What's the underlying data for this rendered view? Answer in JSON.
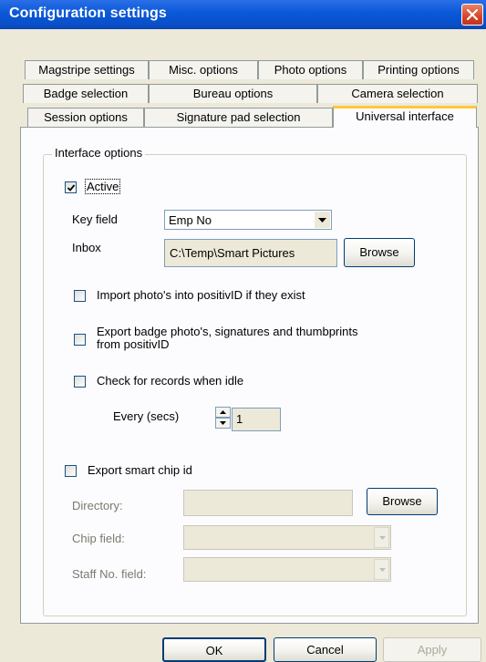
{
  "window": {
    "title": "Configuration settings",
    "close_icon": "close-icon"
  },
  "tabs": {
    "row1": [
      "Magstripe settings",
      "Misc. options",
      "Photo options",
      "Printing options"
    ],
    "row2": [
      "Badge selection",
      "Bureau options",
      "Camera selection"
    ],
    "row3": [
      "Session options",
      "Signature pad selection",
      "Universal interface"
    ],
    "active": "Universal interface"
  },
  "interface": {
    "group_label": "Interface options",
    "active": {
      "label": "Active",
      "checked": true
    },
    "key_field": {
      "label": "Key field",
      "value": "Emp No"
    },
    "inbox": {
      "label": "Inbox",
      "value": "C:\\Temp\\Smart Pictures",
      "browse": "Browse"
    },
    "import_photos": {
      "label": "Import photo's into positivID if they exist",
      "checked": false
    },
    "export_badge": {
      "label_line1": "Export badge photo's, signatures and thumbprints",
      "label_line2": "from positivID",
      "checked": false
    },
    "check_idle": {
      "label": "Check for records when idle",
      "checked": false
    },
    "every": {
      "label": "Every (secs)",
      "value": "1"
    },
    "export_chip": {
      "label": "Export smart chip id",
      "checked": false
    },
    "directory": {
      "label": "Directory:",
      "value": "",
      "browse": "Browse"
    },
    "chip_field": {
      "label": "Chip field:",
      "value": ""
    },
    "staff_field": {
      "label": "Staff No. field:",
      "value": ""
    }
  },
  "buttons": {
    "ok": "OK",
    "cancel": "Cancel",
    "apply": "Apply"
  }
}
